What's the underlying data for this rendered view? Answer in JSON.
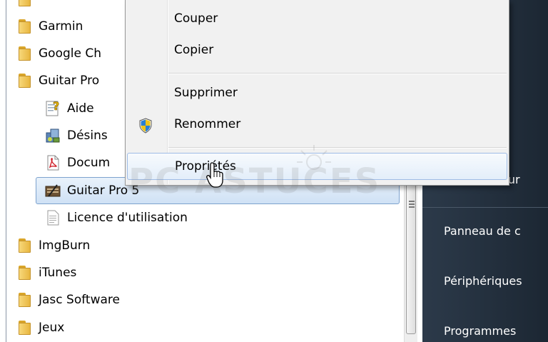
{
  "tree": {
    "items": [
      {
        "label": "Garmin",
        "icon": "folder-icon"
      },
      {
        "label": "Google Ch",
        "icon": "folder-icon"
      },
      {
        "label": "Guitar Pro",
        "icon": "folder-icon"
      },
      {
        "label": "Aide",
        "icon": "help-file-icon"
      },
      {
        "label": "Désins",
        "icon": "uninstall-icon"
      },
      {
        "label": "Docum",
        "icon": "pdf-icon"
      },
      {
        "label": "Guitar Pro 5",
        "icon": "guitar-pro-icon"
      },
      {
        "label": "Licence d'utilisation",
        "icon": "text-document-icon"
      },
      {
        "label": "ImgBurn",
        "icon": "folder-icon"
      },
      {
        "label": "iTunes",
        "icon": "folder-icon"
      },
      {
        "label": "Jasc Software",
        "icon": "folder-icon"
      },
      {
        "label": "Jeux",
        "icon": "folder-icon"
      }
    ]
  },
  "context_menu": {
    "items": {
      "cut": "Couper",
      "copy": "Copier",
      "delete": "Supprimer",
      "rename": "Renommer",
      "properties": "Propriétés"
    },
    "rename_icon": "uac-shield-icon"
  },
  "right_panel": {
    "partial_label": "eur",
    "control_panel": "Panneau de c",
    "devices": "Périphériques",
    "programs": "Programmes"
  },
  "watermark": {
    "text": "PC ASTUCES"
  },
  "colors": {
    "selection_border": "#7da2ce",
    "menu_highlight_border": "#9fbce6",
    "right_panel_bg": "#23303d"
  }
}
